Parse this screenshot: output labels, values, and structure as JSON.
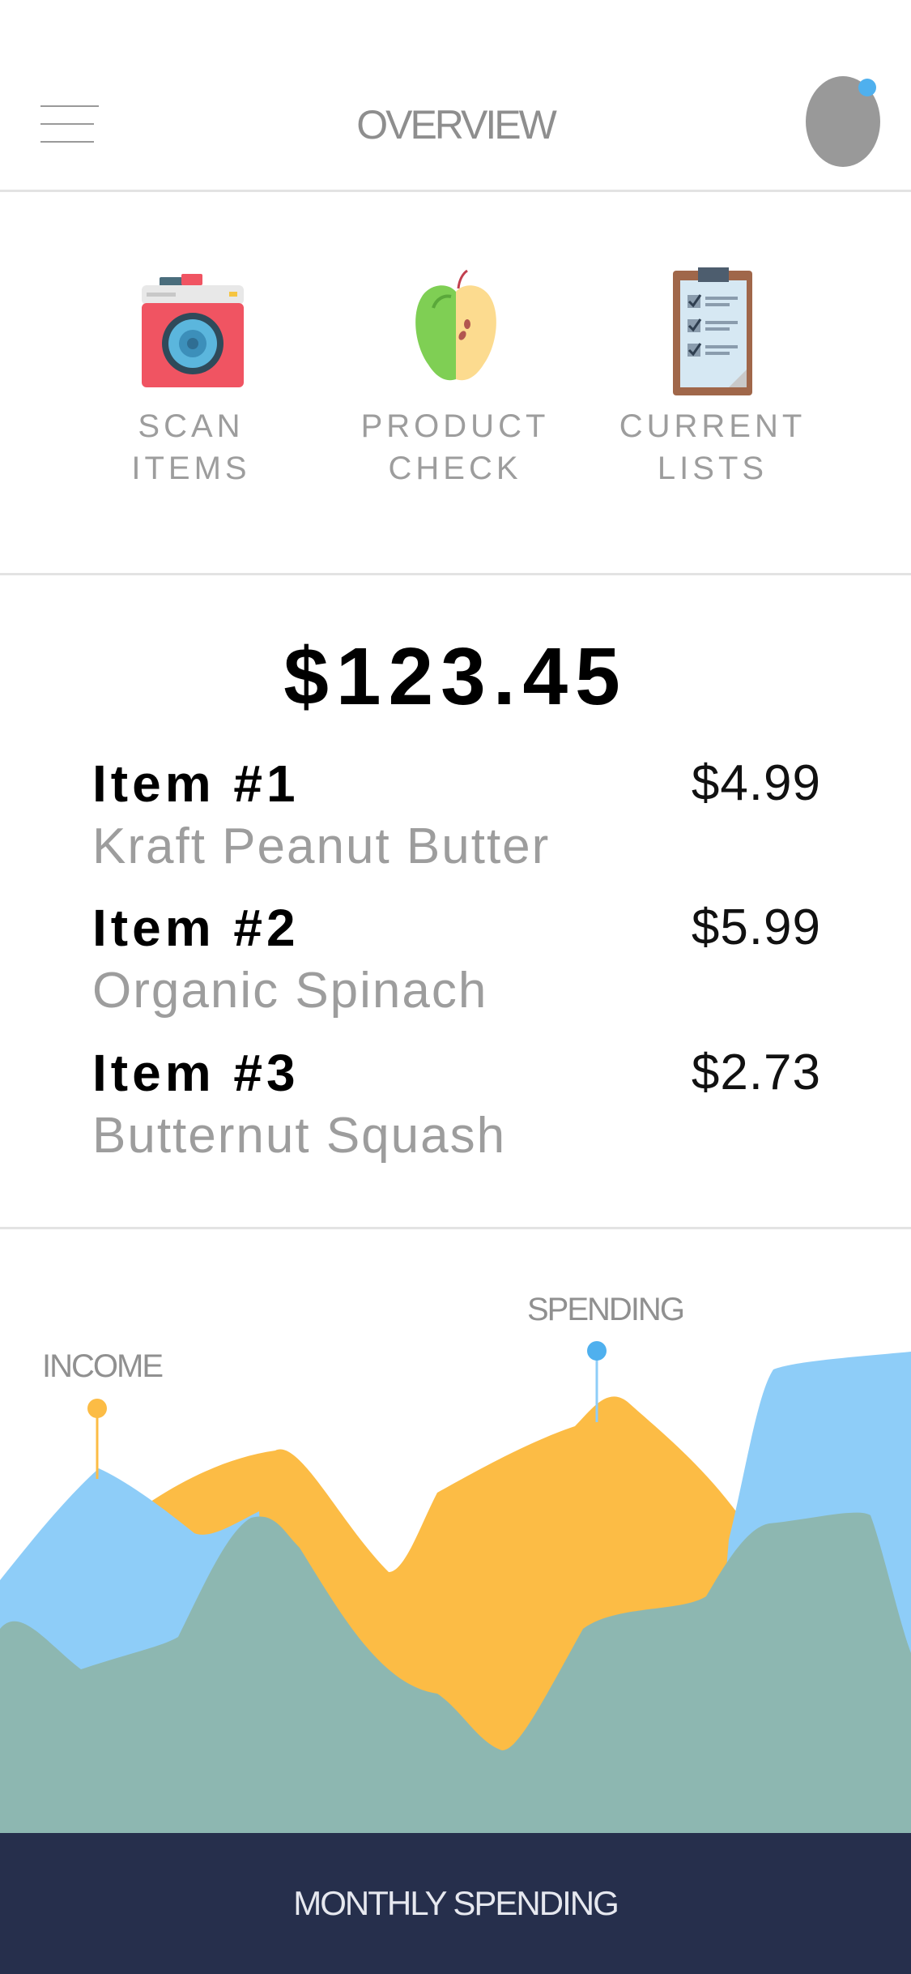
{
  "header": {
    "title": "OVERVIEW"
  },
  "quick_actions": [
    {
      "label_line1": "SCAN",
      "label_line2": "ITEMS",
      "icon": "camera-icon"
    },
    {
      "label_line1": "PRODUCT",
      "label_line2": "CHECK",
      "icon": "apple-icon"
    },
    {
      "label_line1": "CURRENT",
      "label_line2": "LISTS",
      "icon": "clipboard-icon"
    }
  ],
  "summary": {
    "total": "$123.45"
  },
  "items": [
    {
      "name": "Item #1",
      "description": "Kraft Peanut Butter",
      "price": "$4.99"
    },
    {
      "name": "Item #2",
      "description": "Organic Spinach",
      "price": "$5.99"
    },
    {
      "name": "Item #3",
      "description": "Butternut Squash",
      "price": "$2.73"
    }
  ],
  "chart_labels": {
    "income": "INCOME",
    "spending": "SPENDING"
  },
  "footer": {
    "label": "MONTHLY SPENDING"
  },
  "colors": {
    "income": "#8ecdf8",
    "spending": "#fcbc45",
    "overlap": "#8db7b1",
    "footer_bg": "#262f4c",
    "accent_blue": "#4fb0ee"
  }
}
